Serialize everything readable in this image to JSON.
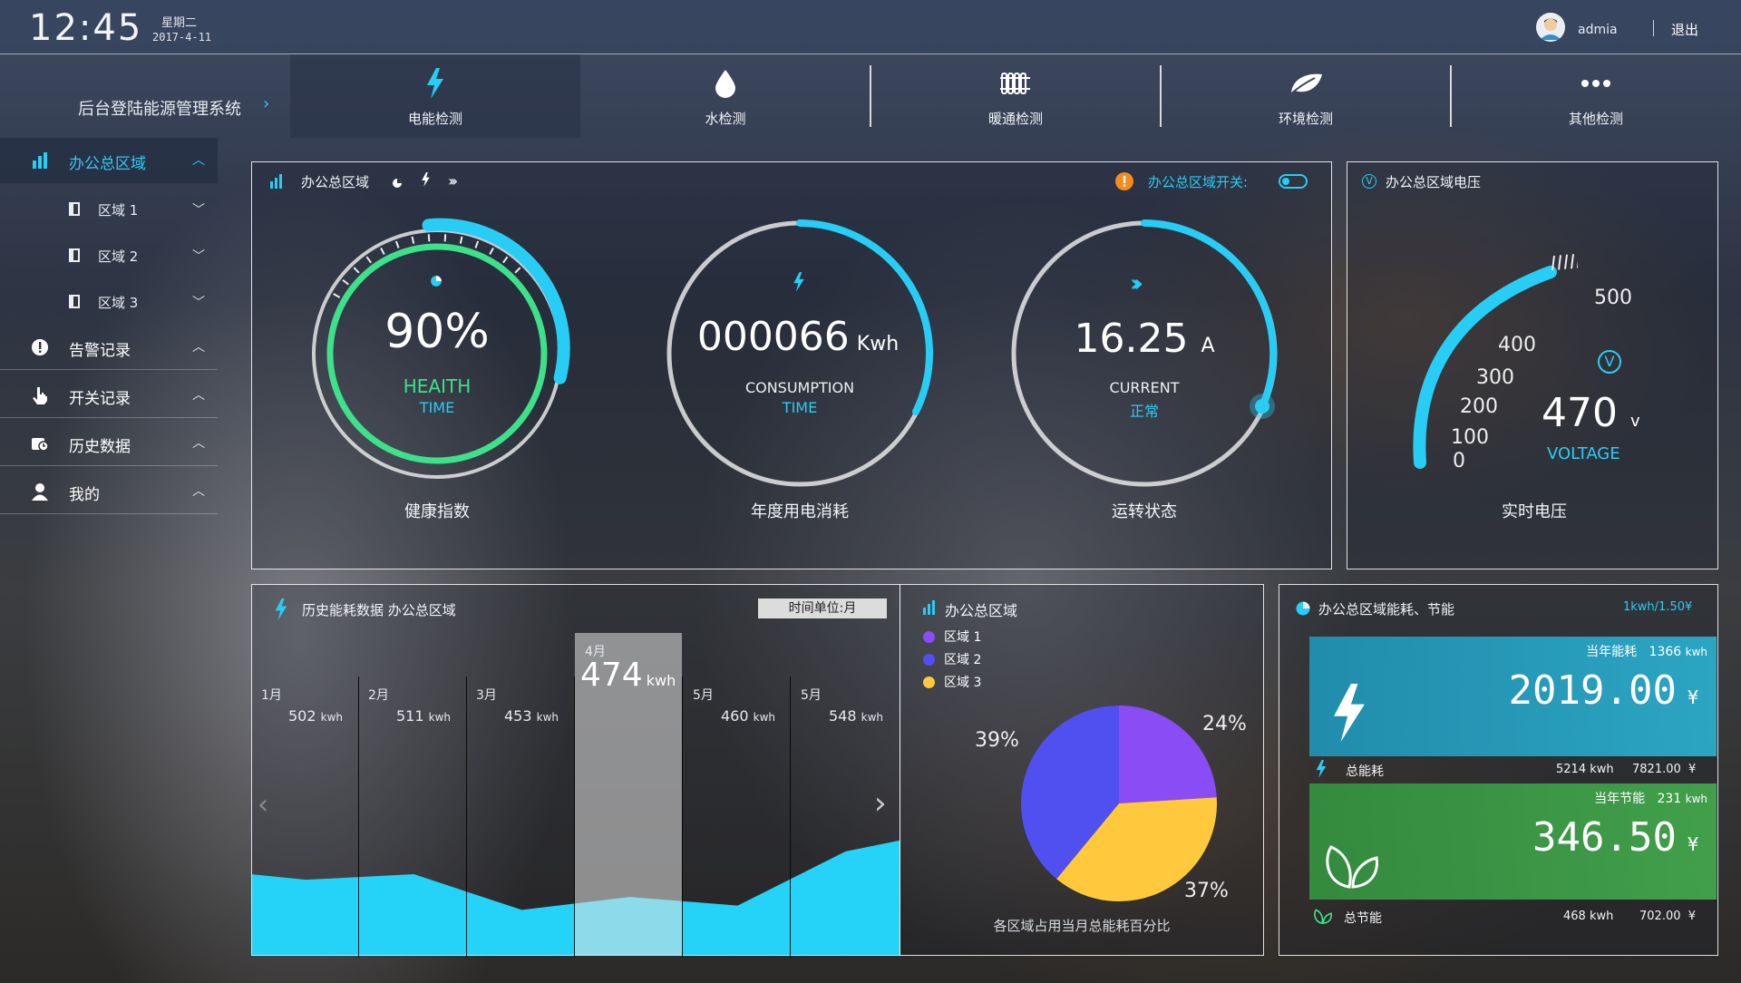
{
  "header": {
    "time": "12:45",
    "weekday": "星期二",
    "date": "2017-4-11",
    "username": "admia",
    "logout_label": "退出"
  },
  "system_title": "后台登陆能源管理系统",
  "nav": {
    "tabs": [
      {
        "label": "电能检测",
        "icon": "lightning-icon",
        "active": true
      },
      {
        "label": "水检测",
        "icon": "water-drop-icon"
      },
      {
        "label": "暖通检测",
        "icon": "radiator-icon"
      },
      {
        "label": "环境检测",
        "icon": "leaf-icon"
      },
      {
        "label": "其他检测",
        "icon": "more-dots-icon"
      }
    ]
  },
  "sidebar": {
    "main": {
      "label": "办公总区域",
      "icon": "building-chart-icon",
      "arrow": "^"
    },
    "subs": [
      {
        "label": "区域 1",
        "arrow": "v"
      },
      {
        "label": "区域 2",
        "arrow": "v"
      },
      {
        "label": "区域 3",
        "arrow": "v"
      }
    ],
    "items": [
      {
        "label": "告警记录",
        "icon": "alert-icon",
        "arrow": "^"
      },
      {
        "label": "开关记录",
        "icon": "hand-pointer-icon",
        "arrow": "^"
      },
      {
        "label": "历史数据",
        "icon": "history-icon",
        "arrow": "^"
      },
      {
        "label": "我的",
        "icon": "user-icon",
        "arrow": "^"
      }
    ]
  },
  "overview": {
    "title": "办公总区域",
    "switch_label": "办公总区域开关:",
    "gauges": [
      {
        "value": "90%",
        "label_en": "HEAITH",
        "sub": "TIME",
        "caption": "健康指数",
        "level": 0.9
      },
      {
        "value": "000066",
        "unit": "Kwh",
        "label_en": "CONSUMPTION",
        "sub": "TIME",
        "caption": "年度用电消耗"
      },
      {
        "value": "16.25",
        "unit": "A",
        "label_en": "CURRENT",
        "sub": "正常",
        "caption": "运转状态"
      }
    ]
  },
  "voltage": {
    "title": "办公总区域电压",
    "scale": [
      "500",
      "400",
      "300",
      "200",
      "100",
      "0"
    ],
    "value": "470",
    "unit": "v",
    "label_en": "VOLTAGE",
    "caption": "实时电压",
    "reading": 470,
    "max": 500
  },
  "history": {
    "title": "历史能耗数据 办公总区域",
    "unit_label": "时间单位:月",
    "months": [
      {
        "month": "1月",
        "value": "502",
        "unit": "kwh"
      },
      {
        "month": "2月",
        "value": "511",
        "unit": "kwh"
      },
      {
        "month": "3月",
        "value": "453",
        "unit": "kwh"
      },
      {
        "month": "4月",
        "value": "474",
        "unit": "kwh",
        "selected": true
      },
      {
        "month": "5月",
        "value": "460",
        "unit": "kwh"
      },
      {
        "month": "5月",
        "value": "548",
        "unit": "kwh"
      }
    ]
  },
  "chart_data": {
    "type": "pie",
    "title": "办公总区域",
    "categories": [
      "区域 1",
      "区域 2",
      "区域 3"
    ],
    "values": [
      24,
      39,
      37
    ],
    "labels": [
      "24%",
      "39%",
      "37%"
    ],
    "colors": [
      "#8a4cf5",
      "#5050f0",
      "#ffc83d"
    ],
    "caption": "各区域占用当月总能耗百分比"
  },
  "energy": {
    "title": "办公总区域能耗、节能",
    "rate": "1kwh/1.50¥",
    "consumption_card": {
      "title": "当年能耗",
      "kwh": "1366",
      "kwh_unit": "kwh",
      "amount": "2019.00",
      "currency": "¥"
    },
    "consumption_total": {
      "label": "总能耗",
      "kwh": "5214",
      "kwh_unit": "kwh",
      "amount": "7821.00",
      "currency": "¥"
    },
    "saving_card": {
      "title": "当年节能",
      "kwh": "231",
      "kwh_unit": "kwh",
      "amount": "346.50",
      "currency": "¥"
    },
    "saving_total": {
      "label": "总节能",
      "kwh": "468",
      "kwh_unit": "kwh",
      "amount": "702.00",
      "currency": "¥"
    }
  },
  "colors": {
    "accent": "#28cdf5",
    "green": "#3ee08a",
    "consumption_card": "#2aa6c8",
    "saving_card": "#3ba84a"
  }
}
